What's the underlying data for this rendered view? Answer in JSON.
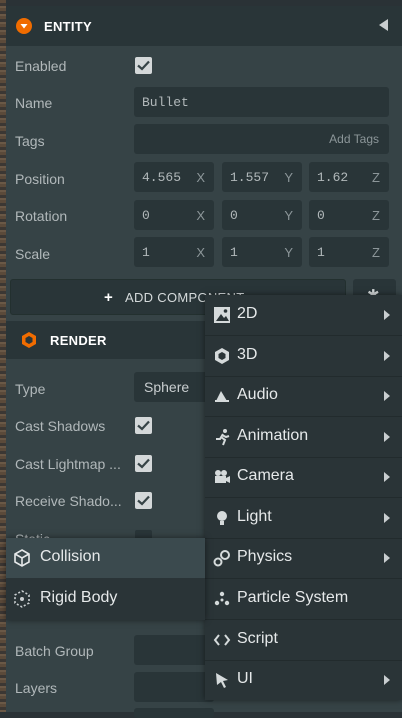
{
  "entity": {
    "title": "ENTITY",
    "enabled_label": "Enabled",
    "enabled": true,
    "name_label": "Name",
    "name_value": "Bullet",
    "tags_label": "Tags",
    "tags_placeholder": "Add Tags",
    "position_label": "Position",
    "position": [
      "4.565",
      "1.557",
      "1.62"
    ],
    "rotation_label": "Rotation",
    "rotation": [
      "0",
      "0",
      "0"
    ],
    "scale_label": "Scale",
    "scale": [
      "1",
      "1",
      "1"
    ],
    "axes": [
      "X",
      "Y",
      "Z"
    ],
    "add_component": "ADD COMPONENT"
  },
  "render": {
    "title": "RENDER",
    "type_label": "Type",
    "type_value": "Sphere",
    "cast_shadows_label": "Cast Shadows",
    "cast_lightmap_label": "Cast Lightmap ...",
    "receive_shadows_label": "Receive Shado...",
    "static_label": "Static",
    "batch_group_label": "Batch Group",
    "layers_label": "Layers"
  },
  "menu": {
    "items": [
      {
        "label": "2D",
        "icon": "image-icon",
        "submenu": true
      },
      {
        "label": "3D",
        "icon": "hexagon-icon",
        "submenu": true
      },
      {
        "label": "Audio",
        "icon": "speaker-icon",
        "submenu": true
      },
      {
        "label": "Animation",
        "icon": "running-figure-icon",
        "submenu": true
      },
      {
        "label": "Camera",
        "icon": "camera-icon",
        "submenu": true
      },
      {
        "label": "Light",
        "icon": "lightbulb-icon",
        "submenu": true
      },
      {
        "label": "Physics",
        "icon": "physics-icon",
        "submenu": true
      },
      {
        "label": "Particle System",
        "icon": "particles-icon",
        "submenu": false
      },
      {
        "label": "Script",
        "icon": "code-icon",
        "submenu": false
      },
      {
        "label": "UI",
        "icon": "cursor-icon",
        "submenu": true
      }
    ]
  },
  "submenu": {
    "items": [
      {
        "label": "Collision",
        "icon": "cube-icon",
        "highlighted": true
      },
      {
        "label": "Rigid Body",
        "icon": "rigidbody-icon",
        "highlighted": false
      }
    ]
  },
  "colors": {
    "accent": "#f06c00",
    "panel": "#364346",
    "field": "#293538",
    "menu": "#2a3437",
    "highlight": "#3b4a4e"
  }
}
